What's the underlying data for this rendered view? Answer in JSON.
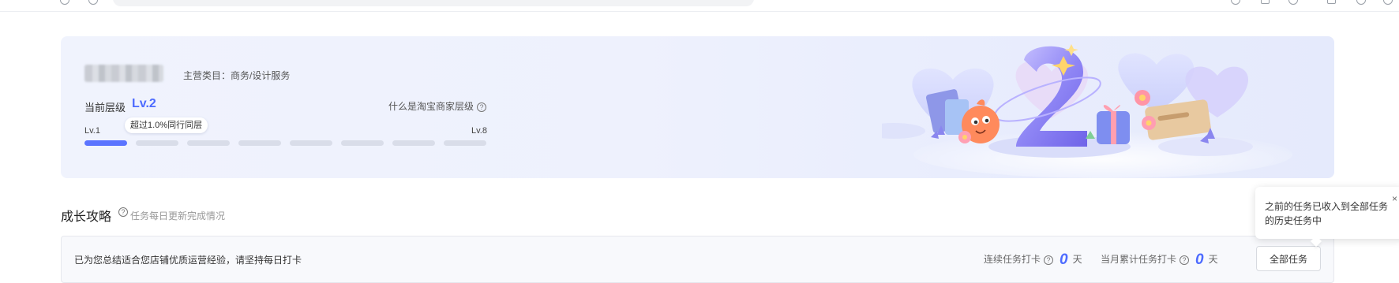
{
  "level_card": {
    "category": "主营类目：商务/设计服务",
    "current_level_label": "当前层级",
    "current_level_value": "Lv.2",
    "what_is_link": "什么是淘宝商家层级",
    "progress_start": "Lv.1",
    "progress_end": "Lv.8",
    "exceed_badge": "超过1.0%同行同层",
    "total_levels": 8,
    "achieved_levels": 1
  },
  "growth": {
    "title": "成长攻略",
    "subtitle": "任务每日更新完成情况"
  },
  "task_bar": {
    "description": "已为您总结适合您店铺优质运营经验，请坚持每日打卡",
    "streak_label": "连续任务打卡",
    "streak_value": "0",
    "streak_unit": "天",
    "monthly_label": "当月累计任务打卡",
    "monthly_value": "0",
    "monthly_unit": "天",
    "all_tasks_button": "全部任务"
  },
  "popover": {
    "text": "之前的任务已收入到全部任务的历史任务中",
    "close": "×"
  },
  "colors": {
    "accent": "#4d6bff",
    "card_bg": "#eef1fd",
    "progress_active": "#5b74ff",
    "progress_inactive": "#d9dde9"
  },
  "icons": [
    "help-icon",
    "close-icon",
    "shield-icon",
    "settings-icon"
  ]
}
